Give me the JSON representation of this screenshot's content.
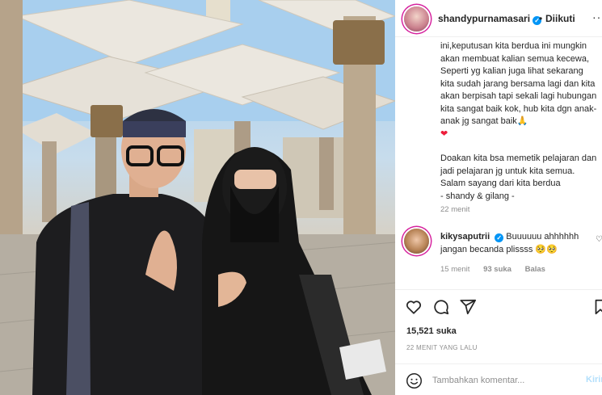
{
  "post": {
    "photo_alt": "",
    "account": {
      "username": "shandypurnamasari",
      "verified_icon": "verified-badge-icon",
      "separator": "•",
      "follow_status": "Diikuti",
      "more_icon": "more-options-icon"
    },
    "caption": {
      "lines_block1": "ini,keputusan kita berdua ini mungkin akan membuat kalian semua kecewa, Seperti yg kalian juga lihat sekarang kita sudah jarang bersama lagi dan kita akan berpisah tapi sekali lagi hubungan kita sangat baik kok, hub kita dgn anak-anak jg sangat baik🙏",
      "heart": "❤",
      "lines_block2": "Doakan kita bsa memetik pelajaran dan jadi pelajaran jg untuk kita semua. Salam sayang dari kita berdua",
      "signature": "- shandy & gilang -",
      "time": "22 menit"
    },
    "comment": {
      "username": "kikysaputrii",
      "text": "Buuuuuu ahhhhhh jangan becanda plissss 🥺🥺",
      "time": "15 menit",
      "likes": "93 suka",
      "reply": "Balas"
    },
    "actions": {
      "like_icon": "heart-icon",
      "comment_icon": "comment-icon",
      "share_icon": "share-icon",
      "save_icon": "bookmark-icon"
    },
    "likes_count": "15,521 suka",
    "posted_ago": "22 MENIT YANG LALU",
    "add_comment": {
      "placeholder": "Tambahkan komentar...",
      "post_label": "Kirim"
    }
  },
  "colors": {
    "accent": "#0095f6",
    "post_button_disabled": "#b2dffc",
    "heart": "#ed1c3a",
    "muted_text": "#8e8e8e"
  }
}
